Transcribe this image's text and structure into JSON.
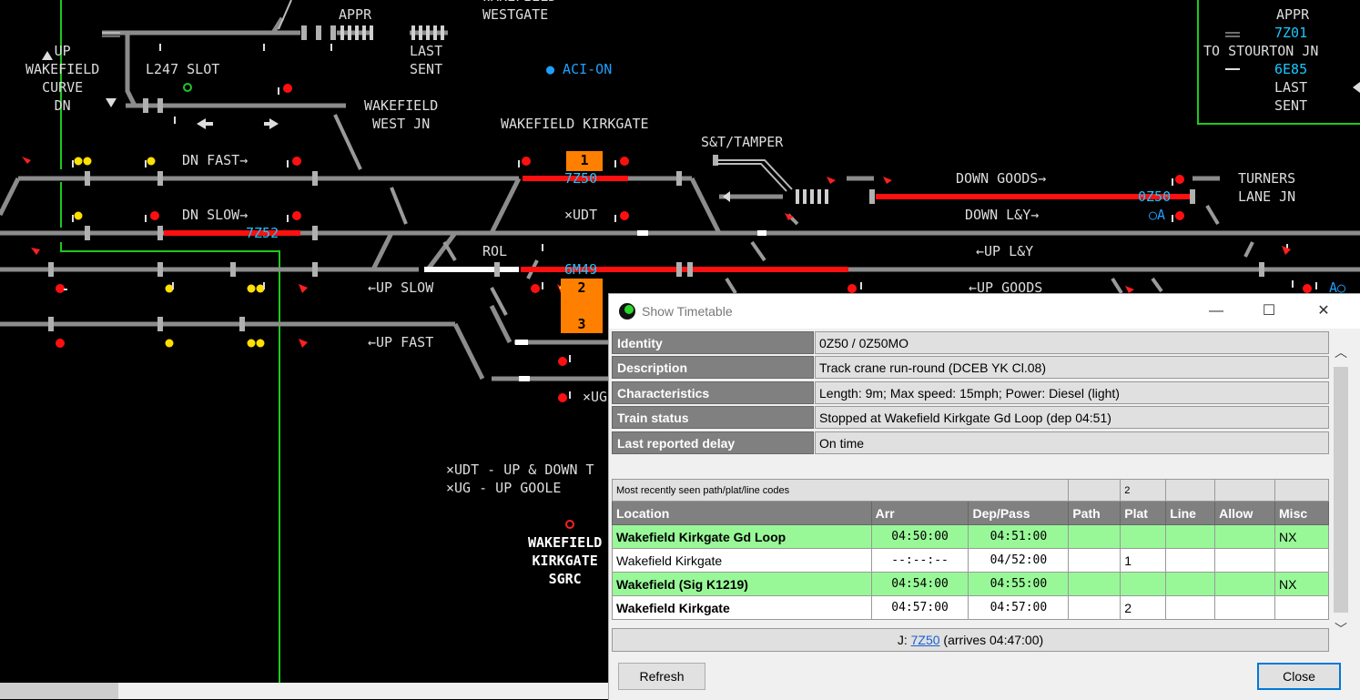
{
  "diagram": {
    "labels": {
      "up_wakefield_curve": "UP\nWAKEFIELD\nCURVE\nDN",
      "l247_slot": "L247 SLOT",
      "appr_left": "APPR",
      "wakefield_westgate": "WAKEFIELD\nWESTGATE",
      "last_sent_left": "LAST\nSENT",
      "aci_on": "● ACI-ON",
      "wakefield_west_jn": "WAKEFIELD\nWEST JN",
      "wakefield_kirkgate": "WAKEFIELD KIRKGATE",
      "st_tamper": "S&T/TAMPER",
      "dn_fast": "DN FAST→",
      "dn_slow": "DN SLOW→",
      "up_slow": "←UP SLOW",
      "up_fast": "←UP FAST",
      "udt_mark": "×UDT",
      "rol": "ROL",
      "down_goods": "DOWN GOODS→",
      "down_ly": "DOWN L&Y→",
      "up_ly": "←UP L&Y",
      "up_goods": "←UP GOODS",
      "turners_lane_jn": "TURNERS\nLANE JN",
      "appr_right": "APPR",
      "to_stourton_jn": "TO STOURTON JN",
      "last_sent_right": "LAST\nSENT",
      "ug_mark": "×UG",
      "legend_udt": "×UDT - UP & DOWN T",
      "legend_ug": "×UG - UP GOOLE",
      "kirkgate_sgrc": "WAKEFIELD\nKIRKGATE\nSGRC",
      "oa_mark": "○A",
      "ao_mark": "A○"
    },
    "berths": {
      "b7z50": "7Z50",
      "b7z52": "7Z52",
      "b6m49": "6M49",
      "b0z50": "0Z50",
      "b7z01": "7Z01",
      "b6e85": "6E85"
    },
    "platforms": [
      "1",
      "2",
      "3"
    ]
  },
  "dialog": {
    "title": "Show Timetable",
    "info": [
      {
        "label": "Identity",
        "value": "0Z50 / 0Z50MO"
      },
      {
        "label": "Description",
        "value": "Track crane run-round (DCEB YK Cl.08)"
      },
      {
        "label": "Characteristics",
        "value": "Length: 9m; Max speed: 15mph; Power: Diesel (light)"
      },
      {
        "label": "Train status",
        "value": "Stopped at Wakefield Kirkgate Gd Loop (dep 04:51)"
      },
      {
        "label": "Last reported delay",
        "value": "On time"
      }
    ],
    "table": {
      "codes_caption": "Most recently seen path/plat/line codes",
      "codes_plat": "2",
      "headers": [
        "Location",
        "Arr",
        "Dep/Pass",
        "Path",
        "Plat",
        "Line",
        "Allow",
        "Misc"
      ],
      "rows": [
        {
          "location": "Wakefield Kirkgate Gd Loop",
          "arr": "04:50:00",
          "dep": "04:51:00",
          "path": "",
          "plat": "",
          "line": "",
          "allow": "",
          "misc": "NX"
        },
        {
          "location": "Wakefield Kirkgate",
          "arr": "--:--:--",
          "dep": "04/52:00",
          "path": "",
          "plat": "1",
          "line": "",
          "allow": "",
          "misc": ""
        },
        {
          "location": "Wakefield (Sig K1219)",
          "arr": "04:54:00",
          "dep": "04:55:00",
          "path": "",
          "plat": "",
          "line": "",
          "allow": "",
          "misc": "NX"
        },
        {
          "location": "Wakefield Kirkgate",
          "arr": "04:57:00",
          "dep": "04:57:00",
          "path": "",
          "plat": "2",
          "line": "",
          "allow": "",
          "misc": ""
        }
      ]
    },
    "footer": {
      "prefix": "J: ",
      "link": "7Z50",
      "suffix": " (arrives 04:47:00)"
    },
    "buttons": {
      "refresh": "Refresh",
      "close": "Close"
    },
    "window_controls": {
      "minimize": "—",
      "maximize": "☐",
      "close": "✕"
    }
  }
}
